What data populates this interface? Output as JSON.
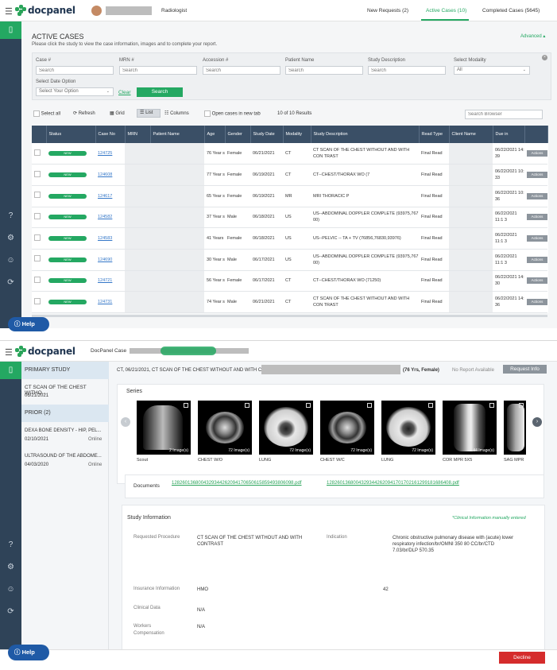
{
  "brand": "docpanel",
  "top": {
    "user_role": "Radiologist",
    "nav": [
      {
        "label": "New Requests (2)"
      },
      {
        "label": "Active Cases (10)"
      },
      {
        "label": "Completed Cases (5645)"
      }
    ],
    "accent": "#24a862",
    "page_title": "ACTIVE CASES",
    "page_subtitle": "Please click the study to view the case information, images and to complete your report.",
    "advanced_label": "Advanced",
    "filters": {
      "case_label": "Case #",
      "case_placeholder": "Search",
      "mrn_label": "MRN #",
      "mrn_placeholder": "Search",
      "accession_label": "Accession #",
      "accession_placeholder": "Search",
      "patient_label": "Patient Name",
      "patient_placeholder": "Search",
      "study_label": "Study Description",
      "study_placeholder": "Search",
      "modality_label": "Select Modality",
      "modality_value": "All",
      "date_label": "Select Date Option",
      "date_value": "Select Your Option",
      "clear_label": "Clear",
      "search_label": "Search"
    },
    "toolbar": {
      "select_all": "Select all",
      "refresh": "Refresh",
      "grid": "Grid",
      "list": "List",
      "columns": "Columns",
      "open_new_tab": "Open cases in new tab",
      "results": "10 of 10 Results",
      "search_browser": "Search Browser"
    },
    "columns": [
      "Status",
      "Case No",
      "MRN",
      "Patient Name",
      "Age",
      "Gender",
      "Study Date",
      "Modality",
      "Study Description",
      "Read Type",
      "Client Name",
      "Due in"
    ],
    "rows": [
      {
        "status": "NEW",
        "case": "124725",
        "age": "76 Year s",
        "gender": "Female",
        "date": "06/21/2021",
        "modality": "CT",
        "desc": "CT SCAN OF THE CHEST WITHOUT AND WITH CON TRAST",
        "read": "Final Read",
        "due": "06/22/2021 14: 39",
        "action": "Actions"
      },
      {
        "status": "NEW",
        "case": "124608",
        "age": "77 Year s",
        "gender": "Female",
        "date": "06/19/2021",
        "modality": "CT",
        "desc": "CT--CHEST/THORAX WO (7",
        "read": "Final Read",
        "due": "06/22/2021 10: 33",
        "action": "Actions"
      },
      {
        "status": "NEW",
        "case": "124617",
        "age": "65 Year s",
        "gender": "Female",
        "date": "06/19/2021",
        "modality": "MR",
        "desc": "MRI THORACIC P",
        "read": "Final Read",
        "due": "06/22/2021 10: 36",
        "action": "Actions"
      },
      {
        "status": "NEW",
        "case": "124582",
        "age": "37 Year s",
        "gender": "Male",
        "date": "06/18/2021",
        "modality": "US",
        "desc": "US--ABDOMINAL DOPPLER COMPLETE (93975,767 00)",
        "read": "Final Read",
        "due": "06/22/2021 11:1 3",
        "action": "Actions"
      },
      {
        "status": "NEW",
        "case": "124583",
        "age": "41 Years",
        "gender": "Female",
        "date": "06/18/2021",
        "modality": "US",
        "desc": "US--PELVIC -- TA + TV (76856,76830,93976)",
        "read": "Final Read",
        "due": "06/22/2021 11:1 3",
        "action": "Actions"
      },
      {
        "status": "NEW",
        "case": "124690",
        "age": "30 Year s",
        "gender": "Male",
        "date": "06/17/2021",
        "modality": "US",
        "desc": "US--ABDOMINAL DOPPLER COMPLETE (93975,767 00)",
        "read": "Final Read",
        "due": "06/22/2021 11:1 3",
        "action": "Actions"
      },
      {
        "status": "NEW",
        "case": "124721",
        "age": "56 Year s",
        "gender": "Female",
        "date": "06/17/2021",
        "modality": "CT",
        "desc": "CT--CHEST/THORAX WO (71250)",
        "read": "Final Read",
        "due": "06/22/2021 14: 30",
        "action": "Actions"
      },
      {
        "status": "NEW",
        "case": "124731",
        "age": "74 Year s",
        "gender": "Male",
        "date": "06/21/2021",
        "modality": "CT",
        "desc": "CT SCAN OF THE CHEST WITHOUT AND WITH CON TRAST",
        "read": "Final Read",
        "due": "06/22/2021 14: 36",
        "action": "Actions"
      }
    ],
    "help": "Help"
  },
  "bottom": {
    "case_title": "DocPanel Case",
    "primary_study": "PRIMARY STUDY",
    "primary_item": {
      "name": "CT SCAN OF THE CHEST WITHO...",
      "date": "06/21/2021"
    },
    "prior_head": "PRIOR (2)",
    "prior_items": [
      {
        "name": "DEXA BONE DENSITY - HIP, PEL...",
        "date": "02/10/2021",
        "status": "Online"
      },
      {
        "name": "ULTRASOUND OF THE ABDOME...",
        "date": "04/03/2020",
        "status": "Online"
      }
    ],
    "header_text": "CT, 06/21/2021, CT SCAN OF THE CHEST WITHOUT AND WITH CONTRAST,",
    "patient_info": "(76 Yrs, Female)",
    "report_status": "No Report Available",
    "request_info": "Request Info",
    "series_title": "Series",
    "series": [
      {
        "label": "Scout",
        "count": "2 Image(s)"
      },
      {
        "label": "CHEST W/O",
        "count": "72 Image(s)"
      },
      {
        "label": "LUNG",
        "count": "72 Image(s)"
      },
      {
        "label": "CHEST W/C",
        "count": "72 Image(s)"
      },
      {
        "label": "LUNG",
        "count": "72 Image(s)"
      },
      {
        "label": "COR MPR 5X5",
        "count": "44 Image(s)"
      },
      {
        "label": "SAG MPR",
        "count": ""
      }
    ],
    "documents_label": "Documents",
    "documents": [
      "1282601368004329344262094170650615859493806098.pdf",
      "12826013680043293442620941701702161299181686408.pdf"
    ],
    "study_info_title": "Study Information",
    "clinical_note": "*Clinical Information manually entered",
    "requested_procedure_label": "Requested Procedure",
    "requested_procedure": "CT SCAN OF THE CHEST WITHOUT AND WITH CONTRAST",
    "indication_label": "Indication",
    "indication": "Chronic obstructive pulmonary disease with (acute) lower respiratory infection/br/OMNI 350 80 CC/br/CTD 7.03/br/DLP 570.35",
    "insurance_label": "Insurance Information",
    "insurance": "HMO",
    "insurance_extra": "42",
    "clinical_data_label": "Clinical Data",
    "clinical_data": "N/A",
    "workers_label": "Workers Compensation",
    "workers": "N/A",
    "help": "Help",
    "decline": "Decline"
  }
}
